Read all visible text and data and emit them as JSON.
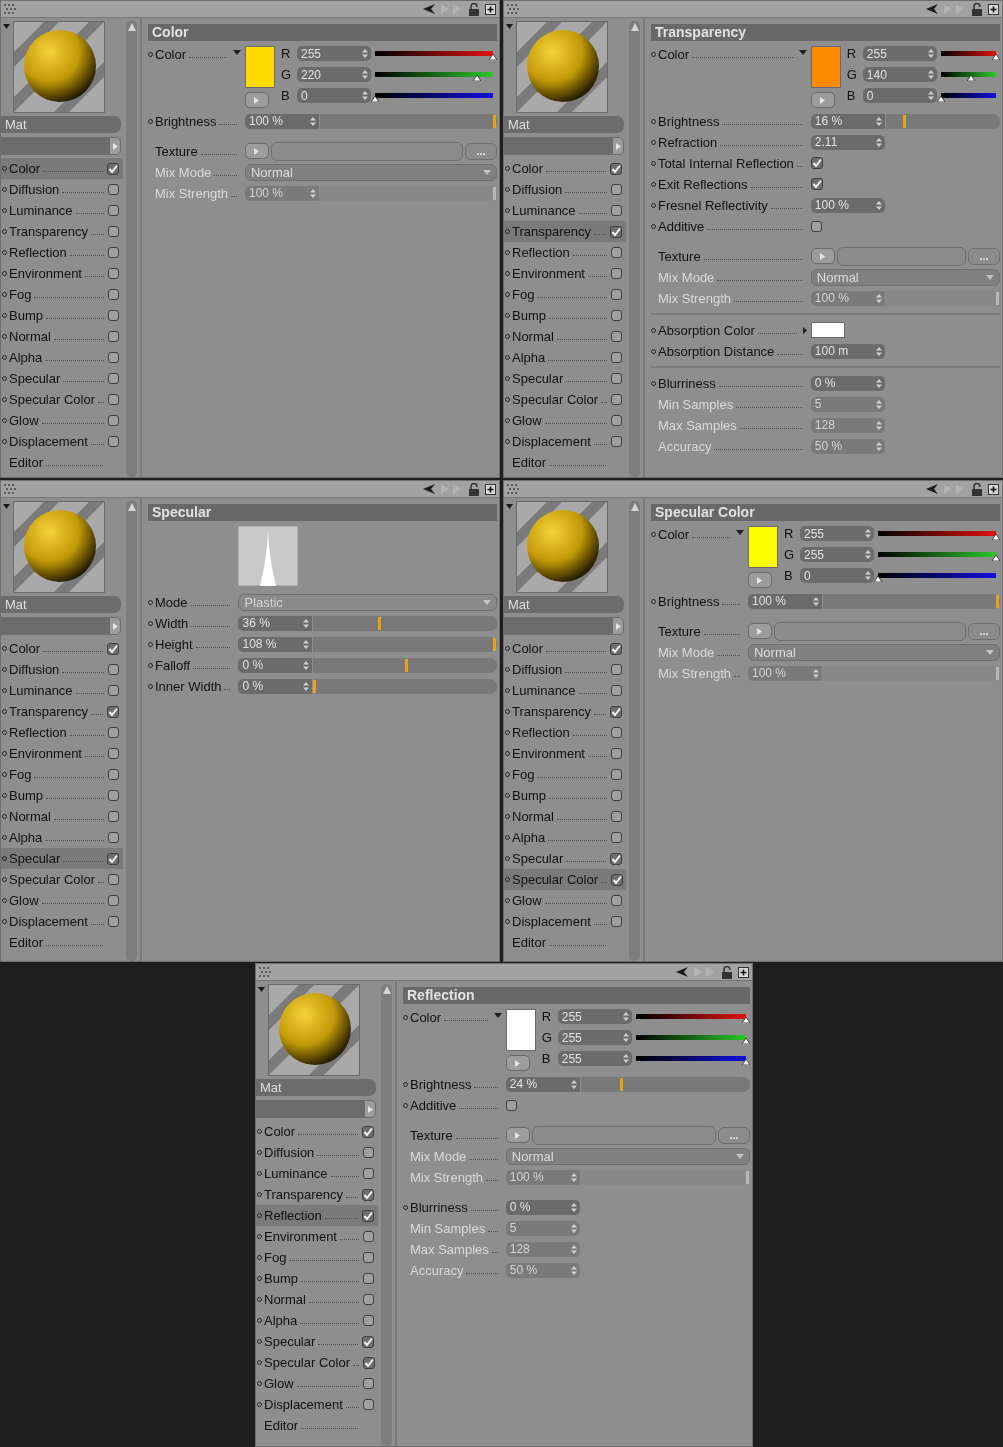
{
  "panels": [
    {
      "material_name": "Mat",
      "section_title": "Color",
      "channels": [
        {
          "kind": "channel",
          "label": "Color",
          "checked": true,
          "selected": true
        },
        {
          "kind": "channel",
          "label": "Diffusion",
          "checked": false,
          "selected": false
        },
        {
          "kind": "channel",
          "label": "Luminance",
          "checked": false,
          "selected": false
        },
        {
          "kind": "channel",
          "label": "Transparency",
          "checked": false,
          "selected": false
        },
        {
          "kind": "channel",
          "label": "Reflection",
          "checked": false,
          "selected": false
        },
        {
          "kind": "channel",
          "label": "Environment",
          "checked": false,
          "selected": false
        },
        {
          "kind": "channel",
          "label": "Fog",
          "checked": false,
          "selected": false
        },
        {
          "kind": "channel",
          "label": "Bump",
          "checked": false,
          "selected": false
        },
        {
          "kind": "channel",
          "label": "Normal",
          "checked": false,
          "selected": false
        },
        {
          "kind": "channel",
          "label": "Alpha",
          "checked": false,
          "selected": false
        },
        {
          "kind": "channel",
          "label": "Specular",
          "checked": false,
          "selected": false
        },
        {
          "kind": "channel",
          "label": "Specular Color",
          "checked": false,
          "selected": false
        },
        {
          "kind": "channel",
          "label": "Glow",
          "checked": false,
          "selected": false
        },
        {
          "kind": "channel",
          "label": "Displacement",
          "checked": false,
          "selected": false
        },
        {
          "kind": "editor",
          "label": "Editor",
          "selected": false
        }
      ],
      "params": [
        {
          "kind": "color",
          "label": "Color",
          "bullet": true,
          "color": "#ffdc00",
          "components": [
            {
              "name": "R",
              "value": "255",
              "level": 1
            },
            {
              "name": "G",
              "value": "220",
              "level": 0.863
            },
            {
              "name": "B",
              "value": "0",
              "level": 0
            }
          ]
        },
        {
          "kind": "slider",
          "label": "Brightness",
          "bullet": true,
          "value": "100 %",
          "level": 1,
          "disabled": false
        },
        {
          "kind": "gap"
        },
        {
          "kind": "texture",
          "label": "Texture",
          "bullet": false,
          "browse": "..."
        },
        {
          "kind": "dropdown",
          "label": "Mix Mode",
          "bullet": false,
          "value": "Normal",
          "disabled": true
        },
        {
          "kind": "slider",
          "label": "Mix Strength",
          "bullet": false,
          "value": "100 %",
          "level": 1,
          "disabled": true
        }
      ]
    },
    {
      "material_name": "Mat",
      "section_title": "Transparency",
      "channels": [
        {
          "kind": "channel",
          "label": "Color",
          "checked": true,
          "selected": false
        },
        {
          "kind": "channel",
          "label": "Diffusion",
          "checked": false,
          "selected": false
        },
        {
          "kind": "channel",
          "label": "Luminance",
          "checked": false,
          "selected": false
        },
        {
          "kind": "channel",
          "label": "Transparency",
          "checked": true,
          "selected": true
        },
        {
          "kind": "channel",
          "label": "Reflection",
          "checked": false,
          "selected": false
        },
        {
          "kind": "channel",
          "label": "Environment",
          "checked": false,
          "selected": false
        },
        {
          "kind": "channel",
          "label": "Fog",
          "checked": false,
          "selected": false
        },
        {
          "kind": "channel",
          "label": "Bump",
          "checked": false,
          "selected": false
        },
        {
          "kind": "channel",
          "label": "Normal",
          "checked": false,
          "selected": false
        },
        {
          "kind": "channel",
          "label": "Alpha",
          "checked": false,
          "selected": false
        },
        {
          "kind": "channel",
          "label": "Specular",
          "checked": false,
          "selected": false
        },
        {
          "kind": "channel",
          "label": "Specular Color",
          "checked": false,
          "selected": false
        },
        {
          "kind": "channel",
          "label": "Glow",
          "checked": false,
          "selected": false
        },
        {
          "kind": "channel",
          "label": "Displacement",
          "checked": false,
          "selected": false
        },
        {
          "kind": "editor",
          "label": "Editor",
          "selected": false
        }
      ],
      "params": [
        {
          "kind": "color",
          "label": "Color",
          "bullet": true,
          "color": "#ff8c00",
          "components": [
            {
              "name": "R",
              "value": "255",
              "level": 1
            },
            {
              "name": "G",
              "value": "140",
              "level": 0.549
            },
            {
              "name": "B",
              "value": "0",
              "level": 0
            }
          ]
        },
        {
          "kind": "slider",
          "label": "Brightness",
          "bullet": true,
          "value": "16 %",
          "level": 0.16,
          "disabled": false
        },
        {
          "kind": "number",
          "label": "Refraction",
          "bullet": true,
          "value": "2.11",
          "disabled": false
        },
        {
          "kind": "checkbox",
          "label": "Total Internal Reflection",
          "bullet": true,
          "checked": true
        },
        {
          "kind": "checkbox",
          "label": "Exit Reflections",
          "bullet": true,
          "checked": true
        },
        {
          "kind": "number",
          "label": "Fresnel Reflectivity",
          "bullet": true,
          "value": "100 %",
          "disabled": false
        },
        {
          "kind": "checkbox",
          "label": "Additive",
          "bullet": true,
          "checked": false
        },
        {
          "kind": "gap"
        },
        {
          "kind": "texture",
          "label": "Texture",
          "bullet": false,
          "browse": "..."
        },
        {
          "kind": "dropdown",
          "label": "Mix Mode",
          "bullet": false,
          "value": "Normal",
          "disabled": true
        },
        {
          "kind": "slider",
          "label": "Mix Strength",
          "bullet": false,
          "value": "100 %",
          "level": 1,
          "disabled": true
        },
        {
          "kind": "separator"
        },
        {
          "kind": "swatch",
          "label": "Absorption Color",
          "bullet": true,
          "color": "#ffffff"
        },
        {
          "kind": "number",
          "label": "Absorption Distance",
          "bullet": true,
          "value": "100 m",
          "disabled": false
        },
        {
          "kind": "separator"
        },
        {
          "kind": "number",
          "label": "Blurriness",
          "bullet": true,
          "value": "0 %",
          "disabled": false
        },
        {
          "kind": "number",
          "label": "Min Samples",
          "bullet": false,
          "value": "5",
          "disabled": true
        },
        {
          "kind": "number",
          "label": "Max Samples",
          "bullet": false,
          "value": "128",
          "disabled": true
        },
        {
          "kind": "number",
          "label": "Accuracy",
          "bullet": false,
          "value": "50 %",
          "disabled": true
        }
      ]
    },
    {
      "material_name": "Mat",
      "section_title": "Specular",
      "channels": [
        {
          "kind": "channel",
          "label": "Color",
          "checked": true,
          "selected": false
        },
        {
          "kind": "channel",
          "label": "Diffusion",
          "checked": false,
          "selected": false
        },
        {
          "kind": "channel",
          "label": "Luminance",
          "checked": false,
          "selected": false
        },
        {
          "kind": "channel",
          "label": "Transparency",
          "checked": true,
          "selected": false
        },
        {
          "kind": "channel",
          "label": "Reflection",
          "checked": false,
          "selected": false
        },
        {
          "kind": "channel",
          "label": "Environment",
          "checked": false,
          "selected": false
        },
        {
          "kind": "channel",
          "label": "Fog",
          "checked": false,
          "selected": false
        },
        {
          "kind": "channel",
          "label": "Bump",
          "checked": false,
          "selected": false
        },
        {
          "kind": "channel",
          "label": "Normal",
          "checked": false,
          "selected": false
        },
        {
          "kind": "channel",
          "label": "Alpha",
          "checked": false,
          "selected": false
        },
        {
          "kind": "channel",
          "label": "Specular",
          "checked": true,
          "selected": true
        },
        {
          "kind": "channel",
          "label": "Specular Color",
          "checked": false,
          "selected": false
        },
        {
          "kind": "channel",
          "label": "Glow",
          "checked": false,
          "selected": false
        },
        {
          "kind": "channel",
          "label": "Displacement",
          "checked": false,
          "selected": false
        },
        {
          "kind": "editor",
          "label": "Editor",
          "selected": false
        }
      ],
      "params": [
        {
          "kind": "curve"
        },
        {
          "kind": "dropdown",
          "label": "Mode",
          "bullet": true,
          "value": "Plastic",
          "disabled": false
        },
        {
          "kind": "slider",
          "label": "Width",
          "bullet": true,
          "value": "36 %",
          "level": 0.36,
          "disabled": false
        },
        {
          "kind": "slider",
          "label": "Height",
          "bullet": true,
          "value": "108 %",
          "level": 1,
          "disabled": false
        },
        {
          "kind": "slider",
          "label": "Falloff",
          "bullet": true,
          "value": "0 %",
          "level": 0.51,
          "disabled": false
        },
        {
          "kind": "slider",
          "label": "Inner Width",
          "bullet": true,
          "value": "0 %",
          "level": 0,
          "disabled": false
        }
      ]
    },
    {
      "material_name": "Mat",
      "section_title": "Specular Color",
      "channels": [
        {
          "kind": "channel",
          "label": "Color",
          "checked": true,
          "selected": false
        },
        {
          "kind": "channel",
          "label": "Diffusion",
          "checked": false,
          "selected": false
        },
        {
          "kind": "channel",
          "label": "Luminance",
          "checked": false,
          "selected": false
        },
        {
          "kind": "channel",
          "label": "Transparency",
          "checked": true,
          "selected": false
        },
        {
          "kind": "channel",
          "label": "Reflection",
          "checked": false,
          "selected": false
        },
        {
          "kind": "channel",
          "label": "Environment",
          "checked": false,
          "selected": false
        },
        {
          "kind": "channel",
          "label": "Fog",
          "checked": false,
          "selected": false
        },
        {
          "kind": "channel",
          "label": "Bump",
          "checked": false,
          "selected": false
        },
        {
          "kind": "channel",
          "label": "Normal",
          "checked": false,
          "selected": false
        },
        {
          "kind": "channel",
          "label": "Alpha",
          "checked": false,
          "selected": false
        },
        {
          "kind": "channel",
          "label": "Specular",
          "checked": true,
          "selected": false
        },
        {
          "kind": "channel",
          "label": "Specular Color",
          "checked": true,
          "selected": true
        },
        {
          "kind": "channel",
          "label": "Glow",
          "checked": false,
          "selected": false
        },
        {
          "kind": "channel",
          "label": "Displacement",
          "checked": false,
          "selected": false
        },
        {
          "kind": "editor",
          "label": "Editor",
          "selected": false
        }
      ],
      "params": [
        {
          "kind": "color",
          "label": "Color",
          "bullet": true,
          "color": "#ffff00",
          "components": [
            {
              "name": "R",
              "value": "255",
              "level": 1
            },
            {
              "name": "G",
              "value": "255",
              "level": 1
            },
            {
              "name": "B",
              "value": "0",
              "level": 0
            }
          ]
        },
        {
          "kind": "slider",
          "label": "Brightness",
          "bullet": true,
          "value": "100 %",
          "level": 1,
          "disabled": false
        },
        {
          "kind": "gap"
        },
        {
          "kind": "texture",
          "label": "Texture",
          "bullet": false,
          "browse": "..."
        },
        {
          "kind": "dropdown",
          "label": "Mix Mode",
          "bullet": false,
          "value": "Normal",
          "disabled": true
        },
        {
          "kind": "slider",
          "label": "Mix Strength",
          "bullet": false,
          "value": "100 %",
          "level": 1,
          "disabled": true
        }
      ]
    },
    {
      "material_name": "Mat",
      "section_title": "Reflection",
      "channels": [
        {
          "kind": "channel",
          "label": "Color",
          "checked": true,
          "selected": false
        },
        {
          "kind": "channel",
          "label": "Diffusion",
          "checked": false,
          "selected": false
        },
        {
          "kind": "channel",
          "label": "Luminance",
          "checked": false,
          "selected": false
        },
        {
          "kind": "channel",
          "label": "Transparency",
          "checked": true,
          "selected": false
        },
        {
          "kind": "channel",
          "label": "Reflection",
          "checked": true,
          "selected": true
        },
        {
          "kind": "channel",
          "label": "Environment",
          "checked": false,
          "selected": false
        },
        {
          "kind": "channel",
          "label": "Fog",
          "checked": false,
          "selected": false
        },
        {
          "kind": "channel",
          "label": "Bump",
          "checked": false,
          "selected": false
        },
        {
          "kind": "channel",
          "label": "Normal",
          "checked": false,
          "selected": false
        },
        {
          "kind": "channel",
          "label": "Alpha",
          "checked": false,
          "selected": false
        },
        {
          "kind": "channel",
          "label": "Specular",
          "checked": true,
          "selected": false
        },
        {
          "kind": "channel",
          "label": "Specular Color",
          "checked": true,
          "selected": false
        },
        {
          "kind": "channel",
          "label": "Glow",
          "checked": false,
          "selected": false
        },
        {
          "kind": "channel",
          "label": "Displacement",
          "checked": false,
          "selected": false
        },
        {
          "kind": "editor",
          "label": "Editor",
          "selected": false
        }
      ],
      "params": [
        {
          "kind": "color",
          "label": "Color",
          "bullet": true,
          "color": "#ffffff",
          "components": [
            {
              "name": "R",
              "value": "255",
              "level": 1
            },
            {
              "name": "G",
              "value": "255",
              "level": 1
            },
            {
              "name": "B",
              "value": "255",
              "level": 1
            }
          ]
        },
        {
          "kind": "slider",
          "label": "Brightness",
          "bullet": true,
          "value": "24 %",
          "level": 0.24,
          "disabled": false
        },
        {
          "kind": "checkbox",
          "label": "Additive",
          "bullet": true,
          "checked": false
        },
        {
          "kind": "gap"
        },
        {
          "kind": "texture",
          "label": "Texture",
          "bullet": false,
          "browse": "..."
        },
        {
          "kind": "dropdown",
          "label": "Mix Mode",
          "bullet": false,
          "value": "Normal",
          "disabled": true
        },
        {
          "kind": "slider",
          "label": "Mix Strength",
          "bullet": false,
          "value": "100 %",
          "level": 1,
          "disabled": true
        },
        {
          "kind": "gap"
        },
        {
          "kind": "number",
          "label": "Blurriness",
          "bullet": true,
          "value": "0 %",
          "disabled": false
        },
        {
          "kind": "number",
          "label": "Min Samples",
          "bullet": false,
          "value": "5",
          "disabled": true
        },
        {
          "kind": "number",
          "label": "Max Samples",
          "bullet": false,
          "value": "128",
          "disabled": true
        },
        {
          "kind": "number",
          "label": "Accuracy",
          "bullet": false,
          "value": "50 %",
          "disabled": true
        }
      ]
    }
  ]
}
